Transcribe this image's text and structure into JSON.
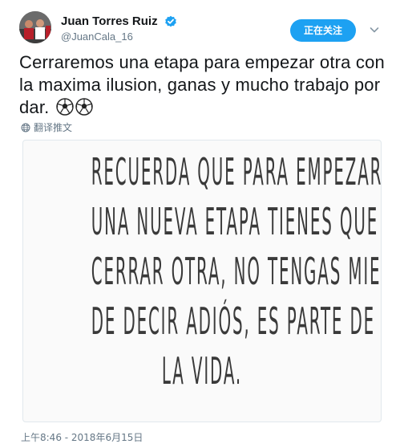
{
  "user": {
    "display_name": "Juan Torres Ruiz",
    "handle": "@JuanCala_16"
  },
  "follow_button_label": "正在关注",
  "tweet": {
    "text": "Cerraremos una etapa para empezar otra con la maxima ilusion, ganas y mucho trabajo por dar.",
    "emoji": [
      "soccer-ball",
      "soccer-ball"
    ]
  },
  "translate_label": "翻译推文",
  "media": {
    "lines": [
      "RECUERDA QUE PARA EMPEZAR",
      "UNA NUEVA ETAPA TIENES QUE",
      "CERRAR OTRA, NO TENGAS MIEDO",
      "DE DECIR ADIÓS, ES PARTE DE",
      "LA VIDA."
    ]
  },
  "timestamp": "上午8:46 - 2018年6月15日",
  "colors": {
    "accent": "#1da1f2",
    "secondary_text": "#657786",
    "primary_text": "#14171a"
  },
  "icons": {
    "verified": "verified-badge-icon",
    "caret": "chevron-down-icon",
    "translate": "globe-icon"
  }
}
